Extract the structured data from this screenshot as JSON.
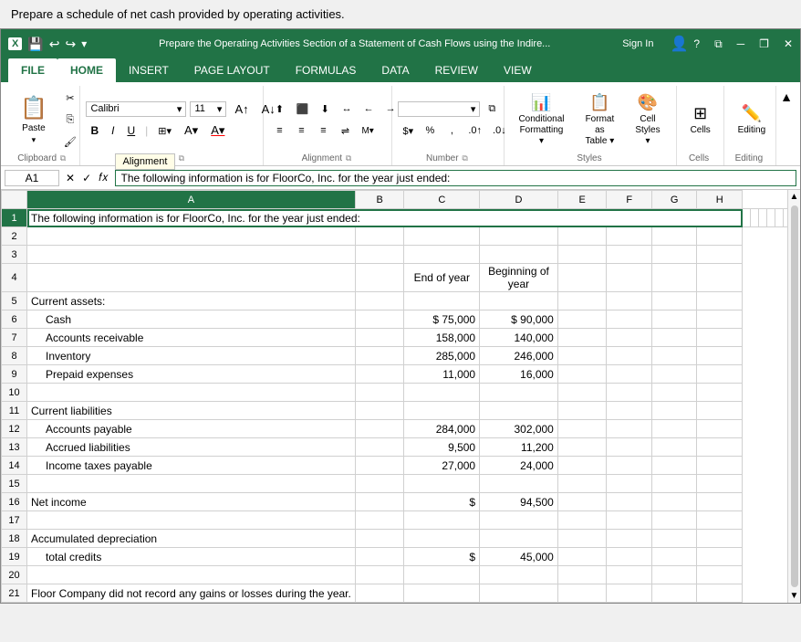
{
  "top_instruction": "Prepare a schedule of net cash provided by operating activities.",
  "window": {
    "title": "Prepare the Operating Activities Section of a Statement of Cash Flows using the Indire...",
    "logo": "X",
    "sign_in": "Sign In"
  },
  "ribbon_tabs": [
    "FILE",
    "HOME",
    "INSERT",
    "PAGE LAYOUT",
    "FORMULAS",
    "DATA",
    "REVIEW",
    "VIEW"
  ],
  "active_tab": "HOME",
  "ribbon": {
    "clipboard": {
      "label": "Clipboard",
      "paste_label": "Paste"
    },
    "font": {
      "label": "Font",
      "name": "Calibri",
      "size": "11",
      "bold": "B",
      "italic": "I",
      "underline": "U"
    },
    "alignment": {
      "label": "Alignment",
      "btn_label": "Alignment"
    },
    "number": {
      "label": "Number",
      "btn_label": "Number",
      "percent_label": "%"
    },
    "styles": {
      "label": "Styles",
      "conditional_formatting": "Conditional\nFormatting",
      "format_as_table": "Format as\nTable",
      "cell_styles": "Cell\nStyles"
    },
    "cells": {
      "label": "Cells",
      "btn_label": "Cells"
    },
    "editing": {
      "label": "Editing",
      "btn_label": "Editing"
    }
  },
  "formula_bar": {
    "cell_ref": "A1",
    "formula": "The following information is for FloorCo, Inc. for the year just ended:"
  },
  "tooltip": "Alignment",
  "columns": [
    "A",
    "B",
    "C",
    "D",
    "E",
    "F",
    "G",
    "H"
  ],
  "rows": [
    {
      "row": 1,
      "cells": [
        "The following information is for FloorCo, Inc. for the year just ended:",
        "",
        "",
        "",
        "",
        "",
        "",
        ""
      ]
    },
    {
      "row": 2,
      "cells": [
        "",
        "",
        "",
        "",
        "",
        "",
        "",
        ""
      ]
    },
    {
      "row": 3,
      "cells": [
        "",
        "",
        "",
        "",
        "",
        "",
        "",
        ""
      ]
    },
    {
      "row": 4,
      "cells": [
        "",
        "",
        "End of year",
        "Beginning of\nyear",
        "",
        "",
        "",
        ""
      ]
    },
    {
      "row": 5,
      "cells": [
        "Current assets:",
        "",
        "",
        "",
        "",
        "",
        "",
        ""
      ]
    },
    {
      "row": 6,
      "cells": [
        "Cash",
        "",
        "$    75,000",
        "$    90,000",
        "",
        "",
        "",
        ""
      ]
    },
    {
      "row": 7,
      "cells": [
        "Accounts receivable",
        "",
        "158,000",
        "140,000",
        "",
        "",
        "",
        ""
      ]
    },
    {
      "row": 8,
      "cells": [
        "Inventory",
        "",
        "285,000",
        "246,000",
        "",
        "",
        "",
        ""
      ]
    },
    {
      "row": 9,
      "cells": [
        "Prepaid expenses",
        "",
        "11,000",
        "16,000",
        "",
        "",
        "",
        ""
      ]
    },
    {
      "row": 10,
      "cells": [
        "",
        "",
        "",
        "",
        "",
        "",
        "",
        ""
      ]
    },
    {
      "row": 11,
      "cells": [
        "Current liabilities",
        "",
        "",
        "",
        "",
        "",
        "",
        ""
      ]
    },
    {
      "row": 12,
      "cells": [
        "Accounts payable",
        "",
        "284,000",
        "302,000",
        "",
        "",
        "",
        ""
      ]
    },
    {
      "row": 13,
      "cells": [
        "Accrued liabilities",
        "",
        "9,500",
        "11,200",
        "",
        "",
        "",
        ""
      ]
    },
    {
      "row": 14,
      "cells": [
        "Income taxes payable",
        "",
        "27,000",
        "24,000",
        "",
        "",
        "",
        ""
      ]
    },
    {
      "row": 15,
      "cells": [
        "",
        "",
        "",
        "",
        "",
        "",
        "",
        ""
      ]
    },
    {
      "row": 16,
      "cells": [
        "Net income",
        "",
        "$",
        "94,500",
        "",
        "",
        "",
        ""
      ]
    },
    {
      "row": 17,
      "cells": [
        "",
        "",
        "",
        "",
        "",
        "",
        "",
        ""
      ]
    },
    {
      "row": 18,
      "cells": [
        "Accumulated depreciation",
        "",
        "",
        "",
        "",
        "",
        "",
        ""
      ]
    },
    {
      "row": 19,
      "cells": [
        "   total credits",
        "",
        "$",
        "45,000",
        "",
        "",
        "",
        ""
      ]
    },
    {
      "row": 20,
      "cells": [
        "",
        "",
        "",
        "",
        "",
        "",
        "",
        ""
      ]
    },
    {
      "row": 21,
      "cells": [
        "Floor Company did not record any gains or losses during the year.",
        "",
        "",
        "",
        "",
        "",
        "",
        ""
      ]
    }
  ]
}
